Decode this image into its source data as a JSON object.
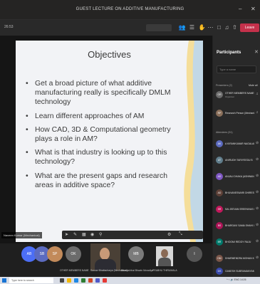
{
  "window": {
    "title": "GUEST LECTURE ON ADDITIVE MANUFACTURING",
    "minimize": "–",
    "close": "✕"
  },
  "toolbar": {
    "timer": "26:53",
    "leave_label": "Leave"
  },
  "slide": {
    "title": "Objectives",
    "bullets": [
      "Get a broad picture of what additive manufacturing really is specifically DMLM technology",
      "Learn different approaches of AM",
      "How CAD, 3D & Computational geometry plays a role in AM?",
      "What is that industry is looking up to this technology?",
      "What are the present gaps and research areas in additive space?"
    ]
  },
  "presenter_tag": "Naveen Kumar (Mechanical)",
  "panel": {
    "title": "Participants",
    "close": "✕",
    "search_placeholder": "Type a name",
    "presenters_label": "Presenters (2)",
    "mute_all": "Mute all",
    "attendees_label": "Attendees (51)",
    "presenters": [
      {
        "initials": "OR",
        "name": "OTHER MEMBERS NAME",
        "sub": "Organiser",
        "color": "#6b6b6b"
      },
      {
        "initials": "RP",
        "name": "Research Person (Mechanical)",
        "sub": "",
        "color": "#8a6f5a"
      }
    ],
    "attendees": [
      {
        "initials": "AK",
        "name": "A KIRANKUMAR NAGALAKSHMI",
        "color": "#5c6bc0"
      },
      {
        "initials": "AT",
        "name": "ANIRUDH TARIYEEDU B",
        "color": "#607d8b"
      },
      {
        "initials": "AD",
        "name": "ANJALI DHAKA (ASHWANI DAGA...",
        "color": "#7e57c2"
      },
      {
        "initials": "AD",
        "name": "BHUVANESWARI DHIRESH GH",
        "color": "#5d4037"
      },
      {
        "initials": "SR",
        "name": "SAI JEEVAN SREENIVAS RAO",
        "color": "#c2185b"
      },
      {
        "initials": "BS",
        "name": "BHARGAVI SAMA SHAHI GAN",
        "color": "#ad1457"
      },
      {
        "initials": "BR",
        "name": "BHOOMI REDDY RAJU",
        "color": "#00796b"
      },
      {
        "initials": "DM",
        "name": "DHARMENDRA MOHAN K",
        "color": "#795548"
      },
      {
        "initials": "DS",
        "name": "GANESH SUBRAMANYAM",
        "color": "#3949ab"
      }
    ]
  },
  "gallery": {
    "tiles": [
      {
        "initials": "AB",
        "name": "",
        "color": "#4c6ef5"
      },
      {
        "initials": "SB",
        "name": "",
        "color": "#5c6bc0"
      },
      {
        "initials": "SP",
        "name": "",
        "color": "#c28a5a"
      },
      {
        "initials": "OK",
        "name": "OTHER MEMBERS NAME",
        "color": "#6b6b6b"
      },
      {
        "initials": "MB",
        "name": "Bhaskarbhai Bhavin Moradiya",
        "color": "#7b7b7b"
      },
      {
        "initials": "I",
        "name": "",
        "color": "#555"
      }
    ],
    "video_name": "Saurav Bhattacharya (Mechanical)",
    "video2_name": "PRABHU THIRUMALA"
  },
  "taskbar": {
    "search_placeholder": "Type here to search",
    "tray": "^ ⌁ 🔊 ENG 14:26"
  }
}
